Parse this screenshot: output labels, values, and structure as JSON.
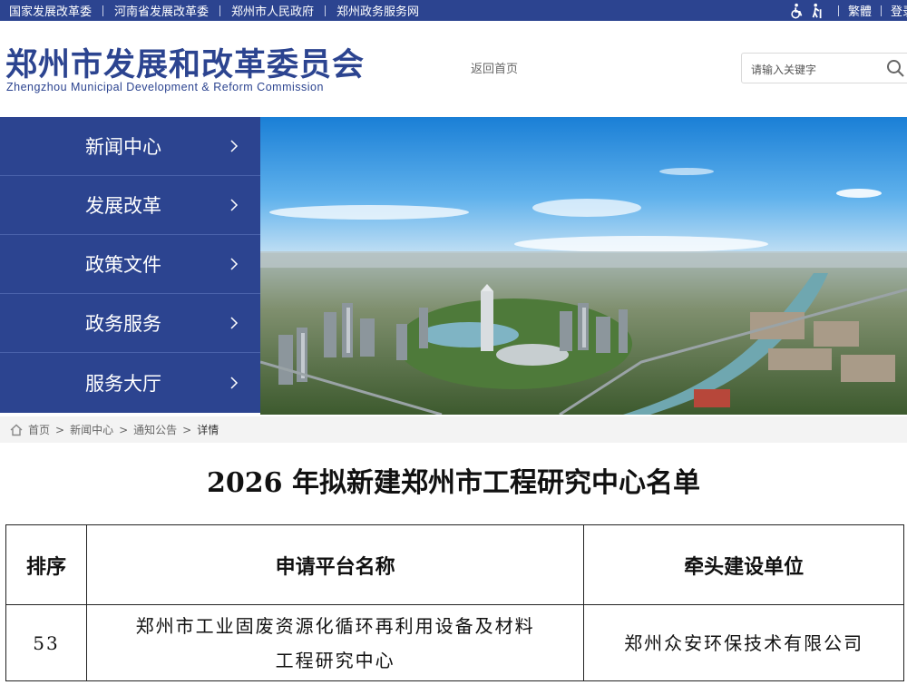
{
  "topbar": {
    "links": [
      "国家发展改革委",
      "河南省发展改革委",
      "郑州市人民政府",
      "郑州政务服务网"
    ],
    "traditional_label": "繁體",
    "login_label": "登录"
  },
  "header": {
    "title": "郑州市发展和改革委员会",
    "subtitle": "Zhengzhou Municipal Development & Reform Commission",
    "home_link": "返回首页",
    "search_placeholder": "请输入关键字"
  },
  "nav": {
    "items": [
      {
        "label": "新闻中心"
      },
      {
        "label": "发展改革"
      },
      {
        "label": "政策文件"
      },
      {
        "label": "政务服务"
      },
      {
        "label": "服务大厅"
      }
    ]
  },
  "breadcrumb": {
    "items": [
      "首页",
      "新闻中心",
      "通知公告",
      "详情"
    ]
  },
  "article": {
    "title": "2026 年拟新建郑州市工程研究中心名单",
    "table": {
      "headers": [
        "排序",
        "申请平台名称",
        "牵头建设单位"
      ],
      "rows": [
        {
          "index": "53",
          "name_line1": "郑州市工业固废资源化循环再利用设备及材料",
          "name_line2": "工程研究中心",
          "unit": "郑州众安环保技术有限公司"
        }
      ]
    }
  },
  "colors": {
    "brand": "#2c4490",
    "breadcrumb_bg": "#f3f3f3"
  }
}
